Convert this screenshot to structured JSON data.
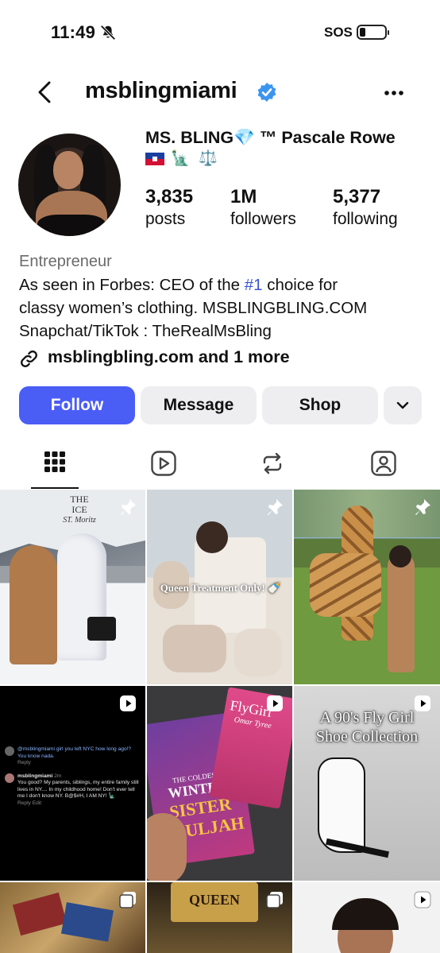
{
  "status_bar": {
    "time": "11:49",
    "sos": "SOS"
  },
  "header": {
    "username": "msblingmiami"
  },
  "profile": {
    "display_name_part1": "MS. BLING",
    "display_name_gem": "💎",
    "display_name_tm": " ™",
    "display_name_part2": " Pascale Rowe",
    "flag_icons": "🗽 ⚖️",
    "stats": [
      {
        "value": "3,835",
        "label": "posts"
      },
      {
        "value": "1M",
        "label": "followers"
      },
      {
        "value": "5,377",
        "label": "following"
      }
    ],
    "category": "Entrepreneur",
    "bio_line1_pre": "As seen in Forbes: CEO of the ",
    "bio_line1_hashtag": "#1",
    "bio_line1_post": " choice for",
    "bio_line2": "classy women’s clothing. MSBLINGBLING.COM",
    "bio_line3": "Snapchat/TikTok : TheRealMsBling",
    "link_text": "msblingbling.com and 1 more"
  },
  "actions": {
    "follow": "Follow",
    "message": "Message",
    "shop": "Shop"
  },
  "tabs": [
    {
      "icon": "grid-icon",
      "active": true
    },
    {
      "icon": "reels-icon",
      "active": false
    },
    {
      "icon": "reposts-icon",
      "active": false
    },
    {
      "icon": "tagged-icon",
      "active": false
    }
  ],
  "posts": {
    "p1": {
      "line1": "THE",
      "line2": "ICE",
      "line3": "ST. Moritz"
    },
    "p2": {
      "caption": "Queen Treatment Only! 🍼"
    },
    "p4": {
      "c1_user": "@msblingmiami girl you left NYC how long ago!? You know nada.",
      "c1_reply": "Reply",
      "c2_user": "msblingmiami",
      "c2_time": "2m",
      "c2_text": "You good? My parents, siblings, my entire family still lives in NY.... In my childhood home! Don't ever tell me I don't know NY. B@$#H, I AM NY! 🗽",
      "c2_actions": "Reply   Edit"
    },
    "p5": {
      "book1_top": "THE COLDEST",
      "book1_mid": "WINTER",
      "book1_author1": "SISTER",
      "book1_author2": "SOULJAH",
      "book2": "FlyGirl",
      "book2_author": "Omar Tyree"
    },
    "p6": {
      "line1": "A 90's Fly Girl",
      "line2": "Shoe Collection"
    },
    "p8": {
      "sign": "QUEEN"
    }
  }
}
